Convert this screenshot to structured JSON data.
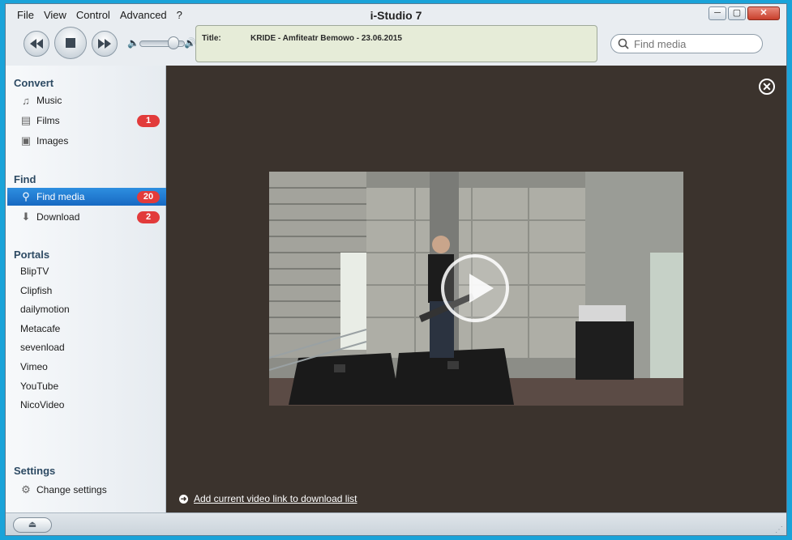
{
  "app": {
    "title": "i-Studio 7"
  },
  "menu": [
    "File",
    "View",
    "Control",
    "Advanced",
    "?"
  ],
  "window_controls": {
    "minimize": "─",
    "maximize": "▢",
    "close": "✕"
  },
  "player": {
    "rewind_icon": "rewind-icon",
    "stop_icon": "stop-icon",
    "forward_icon": "fast-forward-icon",
    "volume_level": 0.75
  },
  "now_playing": {
    "label": "Title:",
    "value": "KRIDE - Amfiteatr Bemowo - 23.06.2015"
  },
  "search": {
    "placeholder": "Find media"
  },
  "sidebar": {
    "convert_title": "Convert",
    "convert_items": [
      {
        "label": "Music",
        "icon": "music-note-icon"
      },
      {
        "label": "Films",
        "icon": "film-icon",
        "badge": "1"
      },
      {
        "label": "Images",
        "icon": "image-icon"
      }
    ],
    "find_title": "Find",
    "find_items": [
      {
        "label": "Find media",
        "icon": "search-icon",
        "badge": "20"
      },
      {
        "label": "Download",
        "icon": "download-arrow-icon",
        "badge": "2"
      }
    ],
    "portals_title": "Portals",
    "portals": [
      "BlipTV",
      "Clipfish",
      "dailymotion",
      "Metacafe",
      "sevenload",
      "Vimeo",
      "YouTube",
      "NicoVideo"
    ],
    "settings_title": "Settings",
    "settings_item": {
      "label": "Change settings",
      "icon": "gear-icon"
    }
  },
  "main": {
    "add_link_text": "Add current video link to download list"
  },
  "colors": {
    "accent_selected": "#1f7ad3",
    "badge": "#e23b3b",
    "main_bg": "#3b332d",
    "title_panel_bg": "#e6ecd8"
  }
}
